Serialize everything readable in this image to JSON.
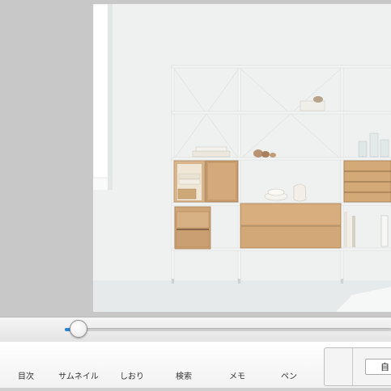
{
  "toolbar": {
    "items": [
      {
        "label": "目次"
      },
      {
        "label": "サムネイル"
      },
      {
        "label": "しおり"
      },
      {
        "label": "検索"
      },
      {
        "label": "メモ"
      },
      {
        "label": "ペン"
      }
    ]
  },
  "side_panel": {
    "button_label": "自"
  },
  "page_slider": {
    "position_fraction": 0.04
  },
  "colors": {
    "accent": "#2a84d6",
    "viewer_background": "#c8c8c8"
  }
}
